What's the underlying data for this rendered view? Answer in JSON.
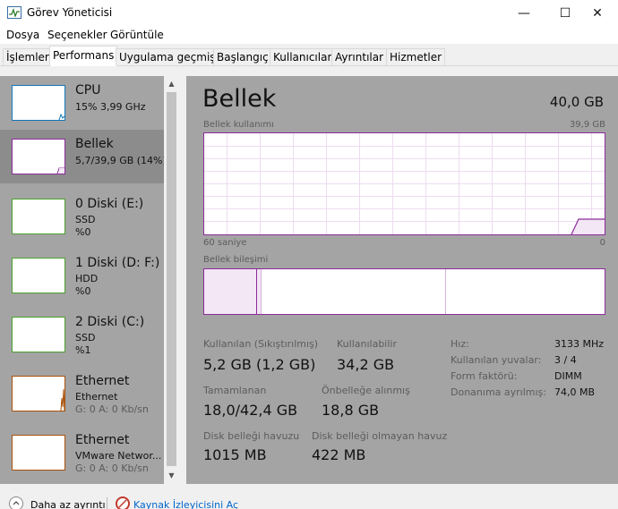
{
  "window": {
    "title": "Görev Yöneticisi",
    "minimize": "—",
    "maximize": "☐",
    "close": "✕"
  },
  "menu": [
    "Dosya",
    "Seçenekler",
    "Görüntüle"
  ],
  "tabs": [
    "İşlemler",
    "Performans",
    "Uygulama geçmişi",
    "Başlangıç",
    "Kullanıcılar",
    "Ayrıntılar",
    "Hizmetler"
  ],
  "active_tab": "Performans",
  "sidebar": {
    "items": [
      {
        "title": "CPU",
        "line1": "15%  3,99 GHz",
        "line2": ""
      },
      {
        "title": "Bellek",
        "line1": "5,7/39,9 GB (14%)",
        "line2": ""
      },
      {
        "title": "0 Diski (E:)",
        "line1": "SSD",
        "line2": "%0"
      },
      {
        "title": "1 Diski (D: F:)",
        "line1": "HDD",
        "line2": "%0"
      },
      {
        "title": "2 Diski (C:)",
        "line1": "SSD",
        "line2": "%1"
      },
      {
        "title": "Ethernet",
        "line1": "Ethernet",
        "line2": "G: 0  A: 0 Kb/sn"
      },
      {
        "title": "Ethernet",
        "line1": "VMware Networ...",
        "line2": "G: 0  A: 0 Kb/sn"
      }
    ],
    "active_index": 1,
    "scroll_up": "▲",
    "scroll_down": "▼"
  },
  "main": {
    "title": "Bellek",
    "total": "40,0 GB",
    "usage_label": "Bellek kullanımı",
    "usage_max": "39,9 GB",
    "time_left": "60 saniye",
    "time_right": "0",
    "composition_label": "Bellek bileşimi",
    "stats": {
      "in_use_label": "Kullanılan (Sıkıştırılmış)",
      "in_use_value": "5,2 GB (1,2 GB)",
      "available_label": "Kullanılabilir",
      "available_value": "34,2 GB",
      "committed_label": "Tamamlanan",
      "committed_value": "18,0/42,4 GB",
      "cached_label": "Önbelleğe alınmış",
      "cached_value": "18,8 GB",
      "paged_label": "Disk belleği havuzu",
      "paged_value": "1015 MB",
      "nonpaged_label": "Disk belleği olmayan havuz",
      "nonpaged_value": "422 MB"
    },
    "details": [
      {
        "key": "Hız:",
        "value": "3133 MHz"
      },
      {
        "key": "Kullanılan yuvalar:",
        "value": "3 / 4"
      },
      {
        "key": "Form faktörü:",
        "value": "DIMM"
      },
      {
        "key": "Donanıma ayrılmış:",
        "value": "74,0 MB"
      }
    ]
  },
  "footer": {
    "fewer_details": "Daha az ayrıntı",
    "resource_monitor": "Kaynak İzleyicisini Aç"
  },
  "colors": {
    "memory_accent": "#8b2c99",
    "disk_accent": "#4aa02c",
    "ethernet_accent": "#a7500a",
    "cpu_accent": "#1177bb",
    "panel_bg": "#a4a4a4",
    "link": "#0066cc"
  }
}
